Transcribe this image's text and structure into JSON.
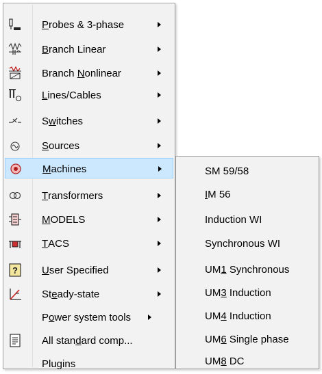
{
  "colors": {
    "menu_background": "#f2f2f2",
    "border": "#a0a0a0",
    "highlight_background": "#cce8ff",
    "highlight_border": "#99d1ff"
  },
  "menu": {
    "items": [
      {
        "pre": "",
        "ul": "P",
        "post": "robes & 3-phase",
        "icon": "probe-icon",
        "submenu": true
      },
      {
        "pre": "",
        "ul": "B",
        "post": "ranch Linear",
        "icon": "branch-linear-icon",
        "submenu": true
      },
      {
        "pre": "Branch ",
        "ul": "N",
        "post": "onlinear",
        "icon": "branch-nonlinear-icon",
        "submenu": true
      },
      {
        "pre": "",
        "ul": "L",
        "post": "ines/Cables",
        "icon": "lines-cables-icon",
        "submenu": true
      },
      {
        "pre": "S",
        "ul": "w",
        "post": "itches",
        "icon": "switch-icon",
        "submenu": true
      },
      {
        "pre": "",
        "ul": "S",
        "post": "ources",
        "icon": "source-icon",
        "submenu": true
      },
      {
        "pre": "",
        "ul": "M",
        "post": "achines",
        "icon": "machine-icon",
        "submenu": true,
        "highlighted": true
      },
      {
        "pre": "",
        "ul": "T",
        "post": "ransformers",
        "icon": "transformer-icon",
        "submenu": true
      },
      {
        "pre": "",
        "ul": "M",
        "post": "ODELS",
        "icon": "models-icon",
        "submenu": true
      },
      {
        "pre": "",
        "ul": "T",
        "post": "ACS",
        "icon": "tacs-icon",
        "submenu": true
      },
      {
        "pre": "",
        "ul": "U",
        "post": "ser Specified",
        "icon": "user-specified-icon",
        "submenu": true
      },
      {
        "pre": "St",
        "ul": "e",
        "post": "ady-state",
        "icon": "steady-state-icon",
        "submenu": true
      },
      {
        "pre": "P",
        "ul": "o",
        "post": "wer system tools",
        "icon": "",
        "submenu": true,
        "inline_arrow": true
      },
      {
        "pre": "All stan",
        "ul": "d",
        "post": "ard comp...",
        "icon": "all-standard-icon",
        "submenu": false
      },
      {
        "pre": "Plugins",
        "ul": "",
        "post": "",
        "icon": "",
        "submenu": false
      }
    ]
  },
  "submenu": {
    "items": [
      {
        "pre": "SM 59/58",
        "ul": "",
        "post": ""
      },
      {
        "pre": "",
        "ul": "I",
        "post": "M 56"
      },
      {
        "pre": "Induction WI",
        "ul": "",
        "post": ""
      },
      {
        "pre": "Synchronous WI",
        "ul": "",
        "post": ""
      },
      {
        "pre": "UM",
        "ul": "1",
        "post": " Synchronous"
      },
      {
        "pre": "UM",
        "ul": "3",
        "post": " Induction"
      },
      {
        "pre": "UM",
        "ul": "4",
        "post": " Induction"
      },
      {
        "pre": "UM",
        "ul": "6",
        "post": " Single phase"
      },
      {
        "pre": "UM",
        "ul": "8",
        "post": " DC"
      }
    ]
  }
}
